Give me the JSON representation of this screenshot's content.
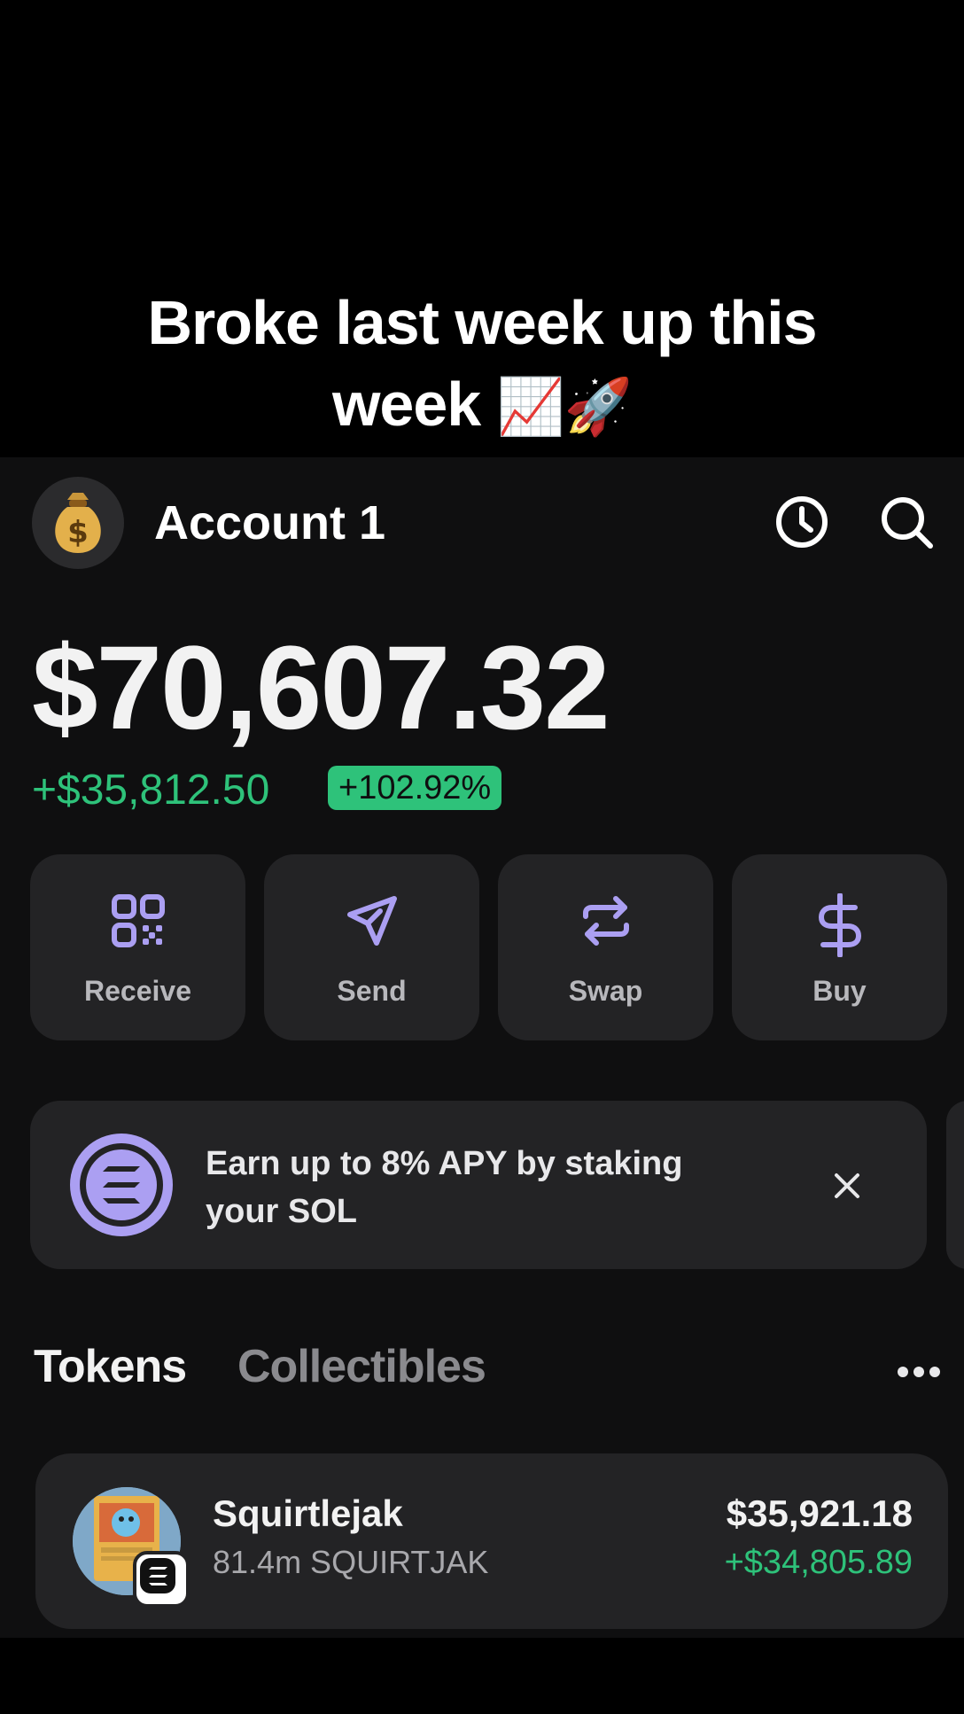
{
  "caption": {
    "line1": "Broke last week up this",
    "line2": "week",
    "emojis": "📈🚀"
  },
  "header": {
    "avatar_icon": "money-bag-icon",
    "account_name": "Account 1",
    "icons": [
      "history-clock-icon",
      "search-icon"
    ]
  },
  "balance": {
    "total": "$70,607.32",
    "change_value": "+$35,812.50",
    "change_percent": "+102.92%"
  },
  "actions": [
    {
      "label": "Receive",
      "icon": "qr-code-icon"
    },
    {
      "label": "Send",
      "icon": "send-icon"
    },
    {
      "label": "Swap",
      "icon": "swap-icon"
    },
    {
      "label": "Buy",
      "icon": "dollar-icon"
    }
  ],
  "banner": {
    "line1": "Earn up to 8% APY by staking",
    "line2": "your SOL",
    "icon": "solana-icon"
  },
  "tabs": {
    "tokens": "Tokens",
    "collectibles": "Collectibles"
  },
  "tokens": [
    {
      "name": "Squirtlejak",
      "amount": "81.4m SQUIRTJAK",
      "value": "$35,921.18",
      "change": "+$34,805.89"
    }
  ],
  "colors": {
    "accent": "#ab9ff2",
    "positive": "#2ec27a",
    "card": "#232325",
    "background": "#0f0f10"
  }
}
